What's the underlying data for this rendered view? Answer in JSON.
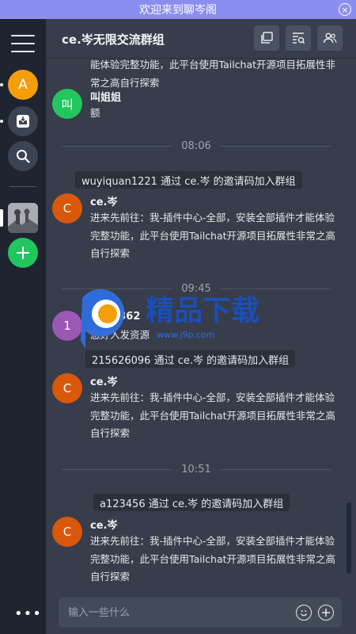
{
  "window": {
    "title": "欢迎来到聊岑阁"
  },
  "sidebar": {
    "avatar_letter": "A",
    "items": [
      "inbox",
      "search",
      "group",
      "add"
    ]
  },
  "header": {
    "title": "ce.岑无限交流群组"
  },
  "messages": {
    "m0": {
      "text": "能体验完整功能，此平台使用Tailchat开源项目拓展性非常之高自行探索"
    },
    "m1": {
      "author": "叫姐姐",
      "avatar": "叫",
      "text": "额"
    },
    "t1": "08:06",
    "s1": "wuyiquan1221 通过 ce.岑 的邀请码加入群组",
    "m2": {
      "author": "ce.岑",
      "avatar": "C",
      "text": "进来先前往：我-插件中心-全部，安装全部插件才能体验完整功能，此平台使用Tailchat开源项目拓展性非常之高自行探索"
    },
    "t2": "09:45",
    "m3": {
      "author": "1****362",
      "avatar": "1",
      "text": "您好入发资源"
    },
    "s2": "215626096 通过 ce.岑 的邀请码加入群组",
    "m4": {
      "author": "ce.岑",
      "avatar": "C",
      "text": "进来先前往：我-插件中心-全部，安装全部插件才能体验完整功能，此平台使用Tailchat开源项目拓展性非常之高自行探索"
    },
    "t3": "10:51",
    "s3": "a123456 通过 ce.岑 的邀请码加入群组",
    "m5": {
      "author": "ce.岑",
      "avatar": "C",
      "text": "进来先前往：我-插件中心-全部，安装全部插件才能体验完整功能，此平台使用Tailchat开源项目拓展性非常之高自行探索"
    }
  },
  "watermark": {
    "brand": "精品下载",
    "url": "www.j9p.com"
  },
  "composer": {
    "placeholder": "输入一些什么"
  },
  "colors": {
    "accent": "#8b8ef0",
    "orange": "#d9580b",
    "green": "#22c55e",
    "purple": "#9b59b6"
  }
}
